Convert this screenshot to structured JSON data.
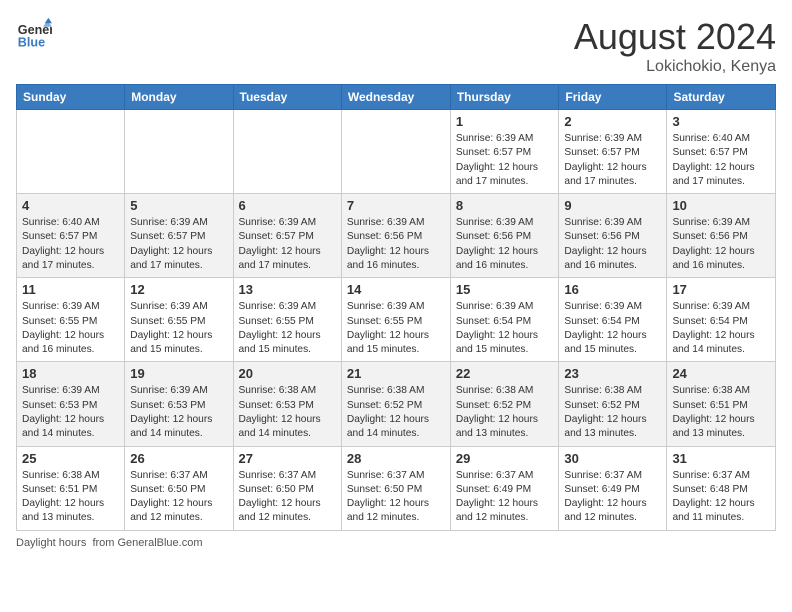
{
  "header": {
    "logo_line1": "General",
    "logo_line2": "Blue",
    "month_title": "August 2024",
    "location": "Lokichokio, Kenya"
  },
  "days_of_week": [
    "Sunday",
    "Monday",
    "Tuesday",
    "Wednesday",
    "Thursday",
    "Friday",
    "Saturday"
  ],
  "weeks": [
    [
      {
        "day": "",
        "info": ""
      },
      {
        "day": "",
        "info": ""
      },
      {
        "day": "",
        "info": ""
      },
      {
        "day": "",
        "info": ""
      },
      {
        "day": "1",
        "info": "Sunrise: 6:39 AM\nSunset: 6:57 PM\nDaylight: 12 hours and 17 minutes."
      },
      {
        "day": "2",
        "info": "Sunrise: 6:39 AM\nSunset: 6:57 PM\nDaylight: 12 hours and 17 minutes."
      },
      {
        "day": "3",
        "info": "Sunrise: 6:40 AM\nSunset: 6:57 PM\nDaylight: 12 hours and 17 minutes."
      }
    ],
    [
      {
        "day": "4",
        "info": "Sunrise: 6:40 AM\nSunset: 6:57 PM\nDaylight: 12 hours and 17 minutes."
      },
      {
        "day": "5",
        "info": "Sunrise: 6:39 AM\nSunset: 6:57 PM\nDaylight: 12 hours and 17 minutes."
      },
      {
        "day": "6",
        "info": "Sunrise: 6:39 AM\nSunset: 6:57 PM\nDaylight: 12 hours and 17 minutes."
      },
      {
        "day": "7",
        "info": "Sunrise: 6:39 AM\nSunset: 6:56 PM\nDaylight: 12 hours and 16 minutes."
      },
      {
        "day": "8",
        "info": "Sunrise: 6:39 AM\nSunset: 6:56 PM\nDaylight: 12 hours and 16 minutes."
      },
      {
        "day": "9",
        "info": "Sunrise: 6:39 AM\nSunset: 6:56 PM\nDaylight: 12 hours and 16 minutes."
      },
      {
        "day": "10",
        "info": "Sunrise: 6:39 AM\nSunset: 6:56 PM\nDaylight: 12 hours and 16 minutes."
      }
    ],
    [
      {
        "day": "11",
        "info": "Sunrise: 6:39 AM\nSunset: 6:55 PM\nDaylight: 12 hours and 16 minutes."
      },
      {
        "day": "12",
        "info": "Sunrise: 6:39 AM\nSunset: 6:55 PM\nDaylight: 12 hours and 15 minutes."
      },
      {
        "day": "13",
        "info": "Sunrise: 6:39 AM\nSunset: 6:55 PM\nDaylight: 12 hours and 15 minutes."
      },
      {
        "day": "14",
        "info": "Sunrise: 6:39 AM\nSunset: 6:55 PM\nDaylight: 12 hours and 15 minutes."
      },
      {
        "day": "15",
        "info": "Sunrise: 6:39 AM\nSunset: 6:54 PM\nDaylight: 12 hours and 15 minutes."
      },
      {
        "day": "16",
        "info": "Sunrise: 6:39 AM\nSunset: 6:54 PM\nDaylight: 12 hours and 15 minutes."
      },
      {
        "day": "17",
        "info": "Sunrise: 6:39 AM\nSunset: 6:54 PM\nDaylight: 12 hours and 14 minutes."
      }
    ],
    [
      {
        "day": "18",
        "info": "Sunrise: 6:39 AM\nSunset: 6:53 PM\nDaylight: 12 hours and 14 minutes."
      },
      {
        "day": "19",
        "info": "Sunrise: 6:39 AM\nSunset: 6:53 PM\nDaylight: 12 hours and 14 minutes."
      },
      {
        "day": "20",
        "info": "Sunrise: 6:38 AM\nSunset: 6:53 PM\nDaylight: 12 hours and 14 minutes."
      },
      {
        "day": "21",
        "info": "Sunrise: 6:38 AM\nSunset: 6:52 PM\nDaylight: 12 hours and 14 minutes."
      },
      {
        "day": "22",
        "info": "Sunrise: 6:38 AM\nSunset: 6:52 PM\nDaylight: 12 hours and 13 minutes."
      },
      {
        "day": "23",
        "info": "Sunrise: 6:38 AM\nSunset: 6:52 PM\nDaylight: 12 hours and 13 minutes."
      },
      {
        "day": "24",
        "info": "Sunrise: 6:38 AM\nSunset: 6:51 PM\nDaylight: 12 hours and 13 minutes."
      }
    ],
    [
      {
        "day": "25",
        "info": "Sunrise: 6:38 AM\nSunset: 6:51 PM\nDaylight: 12 hours and 13 minutes."
      },
      {
        "day": "26",
        "info": "Sunrise: 6:37 AM\nSunset: 6:50 PM\nDaylight: 12 hours and 12 minutes."
      },
      {
        "day": "27",
        "info": "Sunrise: 6:37 AM\nSunset: 6:50 PM\nDaylight: 12 hours and 12 minutes."
      },
      {
        "day": "28",
        "info": "Sunrise: 6:37 AM\nSunset: 6:50 PM\nDaylight: 12 hours and 12 minutes."
      },
      {
        "day": "29",
        "info": "Sunrise: 6:37 AM\nSunset: 6:49 PM\nDaylight: 12 hours and 12 minutes."
      },
      {
        "day": "30",
        "info": "Sunrise: 6:37 AM\nSunset: 6:49 PM\nDaylight: 12 hours and 12 minutes."
      },
      {
        "day": "31",
        "info": "Sunrise: 6:37 AM\nSunset: 6:48 PM\nDaylight: 12 hours and 11 minutes."
      }
    ]
  ],
  "footer": {
    "label": "Daylight hours",
    "site": "GeneralBlue.com"
  },
  "colors": {
    "header_bg": "#3a7bbf",
    "accent": "#3a7bbf"
  }
}
